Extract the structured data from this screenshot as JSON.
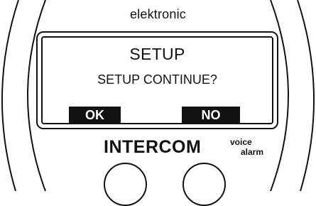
{
  "brand": "elektronic",
  "screen": {
    "title": "SETUP",
    "prompt": "SETUP CONTINUE?",
    "softkeys": {
      "ok": "OK",
      "no": "NO"
    }
  },
  "logo": {
    "main": "INTERCOM",
    "sub_line1": "voice",
    "sub_line2": "alarm"
  },
  "colors": {
    "ink": "#111111",
    "background": "#ffffff"
  }
}
